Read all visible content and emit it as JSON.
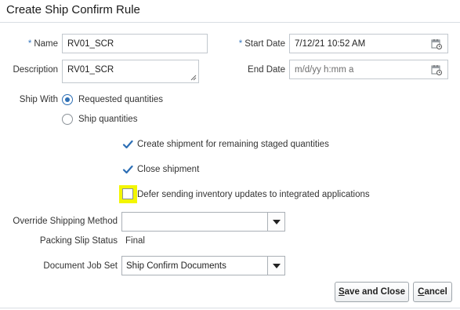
{
  "dialog": {
    "title": "Create Ship Confirm Rule"
  },
  "form": {
    "name": {
      "required_marker": "*",
      "label": "Name",
      "value": "RV01_SCR"
    },
    "description": {
      "label": "Description",
      "value": "RV01_SCR"
    },
    "start_date": {
      "required_marker": "*",
      "label": "Start Date",
      "value": "7/12/21 10:52 AM",
      "icon": "calendar-icon"
    },
    "end_date": {
      "label": "End Date",
      "placeholder": "m/d/yy h:mm a",
      "icon": "calendar-icon"
    },
    "ship_with": {
      "label": "Ship With",
      "options": [
        {
          "label": "Requested quantities",
          "selected": true
        },
        {
          "label": "Ship quantities",
          "selected": false
        }
      ]
    },
    "checkboxes": [
      {
        "label": "Create shipment for remaining staged quantities",
        "checked": true
      },
      {
        "label": "Close shipment",
        "checked": true
      },
      {
        "label": "Defer sending inventory updates to integrated applications",
        "checked": false,
        "highlight_color": "#f3f600"
      }
    ],
    "override_shipping_method": {
      "label": "Override Shipping Method",
      "value": ""
    },
    "packing_slip_status": {
      "label": "Packing Slip Status",
      "value": "Final"
    },
    "document_job_set": {
      "label": "Document Job Set",
      "value": "Ship Confirm Documents"
    }
  },
  "buttons": {
    "save_close": {
      "mnemonic": "S",
      "rest": "ave and Close"
    },
    "cancel": {
      "mnemonic": "C",
      "rest": "ancel"
    }
  },
  "colors": {
    "accent": "#2d6fb5",
    "required": "#3a7ac0",
    "highlight": "#f3f600"
  }
}
